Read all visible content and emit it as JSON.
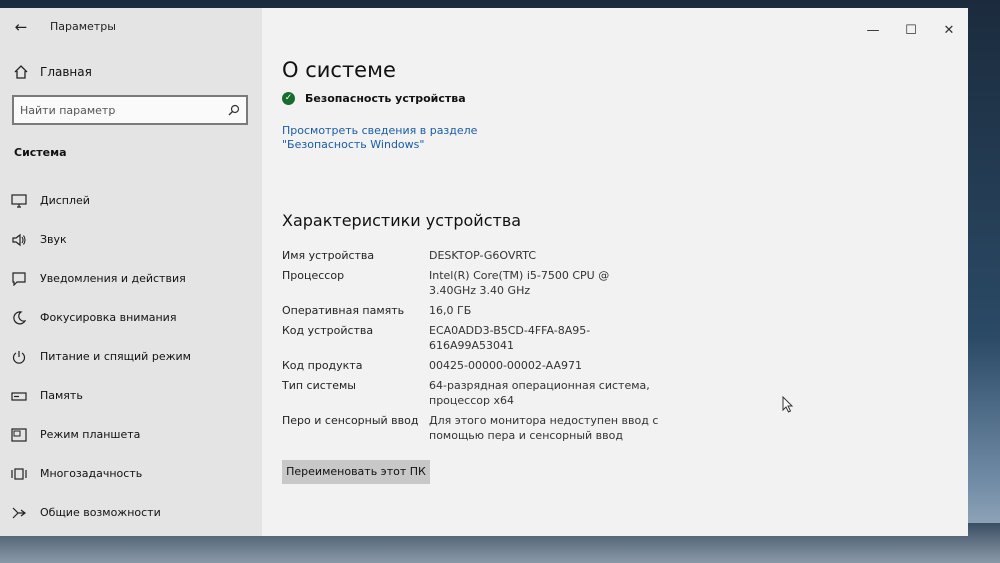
{
  "window": {
    "app_title": "Параметры",
    "controls": {
      "minimize": "—",
      "maximize": "☐",
      "close": "✕"
    }
  },
  "sidebar": {
    "home_label": "Главная",
    "search_placeholder": "Найти параметр",
    "section_label": "Система",
    "items": [
      {
        "label": "Дисплей",
        "icon": "monitor-icon"
      },
      {
        "label": "Звук",
        "icon": "speaker-icon"
      },
      {
        "label": "Уведомления и действия",
        "icon": "notification-icon"
      },
      {
        "label": "Фокусировка внимания",
        "icon": "moon-icon"
      },
      {
        "label": "Питание и спящий режим",
        "icon": "power-icon"
      },
      {
        "label": "Память",
        "icon": "storage-icon"
      },
      {
        "label": "Режим планшета",
        "icon": "tablet-icon"
      },
      {
        "label": "Многозадачность",
        "icon": "multitask-icon"
      },
      {
        "label": "Общие возможности",
        "icon": "share-icon"
      }
    ]
  },
  "main": {
    "title": "О системе",
    "security_status": "Безопасность устройства",
    "security_link": "Просмотреть сведения в разделе \"Безопасность Windows\"",
    "specs_title": "Характеристики устройства",
    "specs": [
      {
        "key": "Имя устройства",
        "value": "DESKTOP-G6OVRTC"
      },
      {
        "key": "Процессор",
        "value": "Intel(R) Core(TM) i5-7500 CPU @ 3.40GHz 3.40 GHz"
      },
      {
        "key": "Оперативная память",
        "value": "16,0 ГБ"
      },
      {
        "key": "Код устройства",
        "value": "ECA0ADD3-B5CD-4FFA-8A95-616A99A53041"
      },
      {
        "key": "Код продукта",
        "value": "00425-00000-00002-AA971"
      },
      {
        "key": "Тип системы",
        "value": "64-разрядная операционная система, процессор x64"
      },
      {
        "key": "Перо и сенсорный ввод",
        "value": "Для этого монитора недоступен ввод с помощью пера и сенсорный ввод"
      }
    ],
    "rename_button": "Переименовать этот ПК"
  },
  "colors": {
    "accent": "#1a5ca8",
    "security_ok": "#1a6b2e",
    "sidebar_bg": "#e4e4e4",
    "main_bg": "#f2f2f2"
  }
}
